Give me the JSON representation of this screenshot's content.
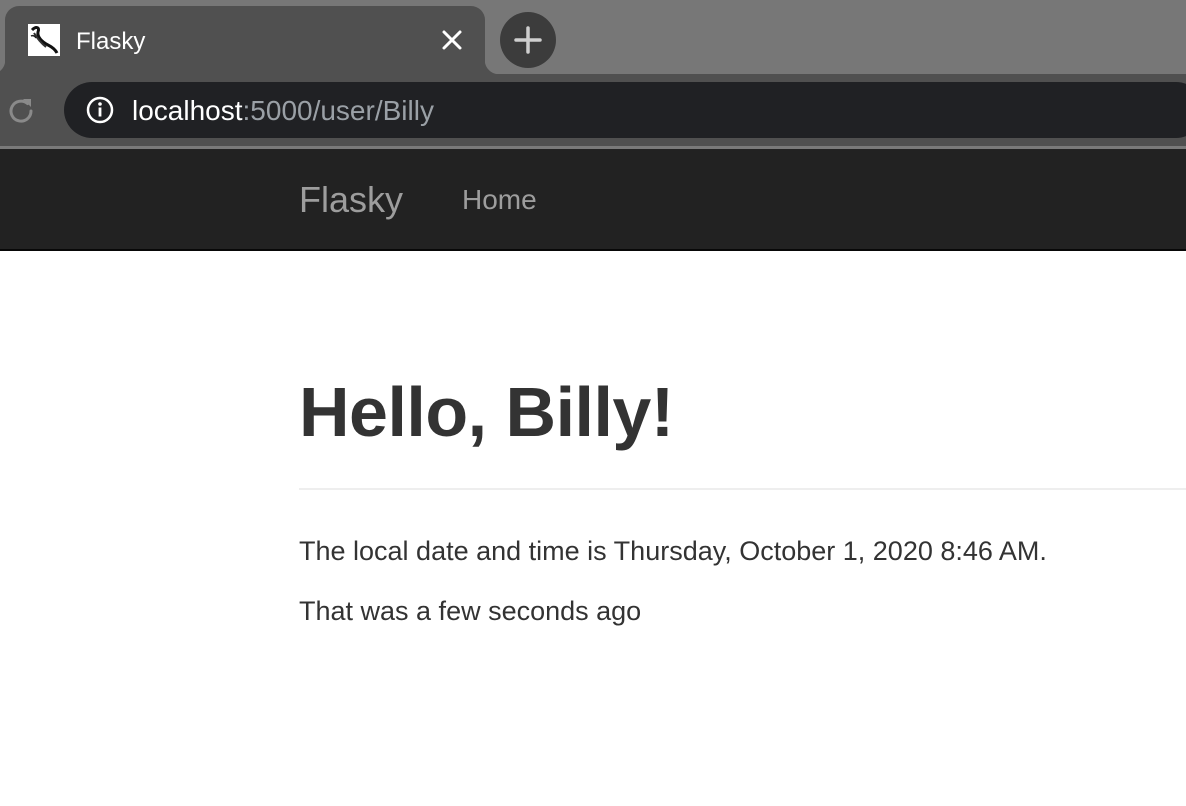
{
  "browser": {
    "tab": {
      "title": "Flasky",
      "favicon": "flask-favicon-icon"
    },
    "address_bar": {
      "host": "localhost",
      "path": ":5000/user/Billy"
    },
    "icons": {
      "close": "close-icon",
      "new_tab": "plus-icon",
      "reload": "reload-icon",
      "site_info": "info-icon"
    }
  },
  "navbar": {
    "brand": "Flasky",
    "links": [
      {
        "label": "Home"
      }
    ]
  },
  "main": {
    "heading": "Hello, Billy!",
    "datetime_line": "The local date and time is Thursday, October 1, 2020 8:46 AM.",
    "relative_line": "That was a few seconds ago"
  },
  "colors": {
    "navbar_bg": "#222222",
    "nav_text": "#9d9d9d",
    "text": "#333333",
    "chrome_dark": "#202124"
  }
}
